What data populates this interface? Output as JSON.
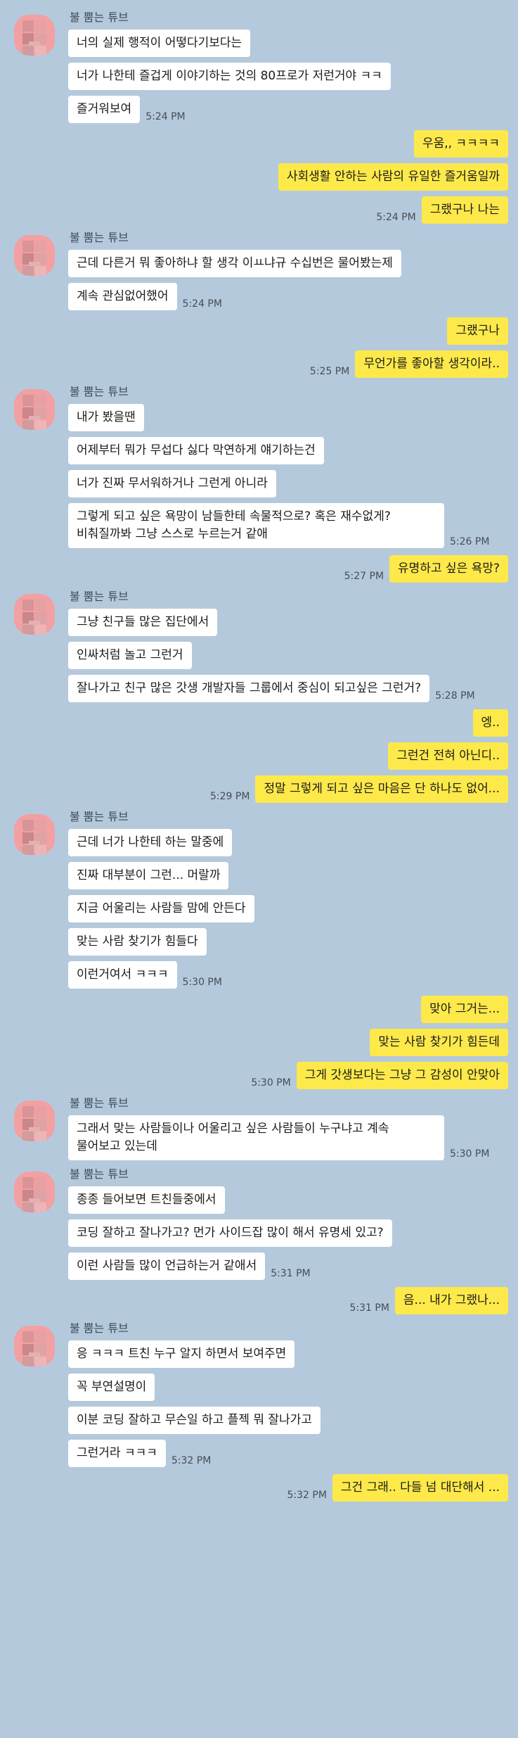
{
  "conversation": {
    "groups": [
      {
        "side": "in",
        "name": "불 뿜는 튜브",
        "messages": [
          {
            "text": "너의 실제 행적이 어떻다기보다는",
            "time": ""
          },
          {
            "text": "너가 나한테 즐겁게 이야기하는 것의 80프로가 저런거야 ㅋㅋ",
            "time": ""
          },
          {
            "text": "즐거워보여",
            "time": "5:24 PM"
          }
        ]
      },
      {
        "side": "out",
        "messages": [
          {
            "text": "우움,, ㅋㅋㅋㅋ",
            "time": ""
          },
          {
            "text": "사회생활 안하는 사람의 유일한 즐거움일까",
            "time": ""
          },
          {
            "text": "그랬구나 나는",
            "time": "5:24 PM"
          }
        ]
      },
      {
        "side": "in",
        "name": "불 뿜는 튜브",
        "messages": [
          {
            "text": "근데 다른거 뭐 좋아하냐 할 생각 이ㅛ냐규 수십번은 물어봤는제",
            "time": ""
          },
          {
            "text": "계속 관심없어했어",
            "time": "5:24 PM"
          }
        ]
      },
      {
        "side": "out",
        "messages": [
          {
            "text": "그랬구나",
            "time": ""
          },
          {
            "text": "무언가를 좋아할 생각이라..",
            "time": "5:25 PM"
          }
        ]
      },
      {
        "side": "in",
        "name": "불 뿜는 튜브",
        "messages": [
          {
            "text": "내가 봤을땐",
            "time": ""
          },
          {
            "text": "어제부터 뭐가 무섭다 싫다 막연하게 얘기하는건",
            "time": ""
          },
          {
            "text": "너가 진짜 무서워하거나 그런게 아니라",
            "time": ""
          },
          {
            "text": "그렇게 되고 싶은 욕망이 남들한테 속물적으로? 혹은 재수없게? 비춰질까봐 그냥 스스로 누르는거 같애",
            "time": "5:26 PM"
          }
        ]
      },
      {
        "side": "out",
        "messages": [
          {
            "text": "유명하고 싶은 욕망?",
            "time": "5:27 PM"
          }
        ]
      },
      {
        "side": "in",
        "name": "불 뿜는 튜브",
        "messages": [
          {
            "text": "그냥 친구들 많은 집단에서",
            "time": ""
          },
          {
            "text": "인싸처럼 놀고 그런거",
            "time": ""
          },
          {
            "text": "잘나가고 친구 많은 갓생 개발자들 그룹에서 중심이 되고싶은 그런거?",
            "time": "5:28 PM"
          }
        ]
      },
      {
        "side": "out",
        "messages": [
          {
            "text": "엥..",
            "time": ""
          },
          {
            "text": "그런건 전혀 아닌디..",
            "time": ""
          },
          {
            "text": "정말 그렇게 되고 싶은 마음은 단 하나도 없어...",
            "time": "5:29 PM"
          }
        ]
      },
      {
        "side": "in",
        "name": "불 뿜는 튜브",
        "messages": [
          {
            "text": "근데 너가 나한테 하는 말중에",
            "time": ""
          },
          {
            "text": "진짜 대부분이 그런... 머랄까",
            "time": ""
          },
          {
            "text": "지금 어울리는 사람들 맘에 안든다",
            "time": ""
          },
          {
            "text": "맞는 사람 찾기가 힘들다",
            "time": ""
          },
          {
            "text": "이런거여서 ㅋㅋㅋ",
            "time": "5:30 PM"
          }
        ]
      },
      {
        "side": "out",
        "messages": [
          {
            "text": "맞아 그거는...",
            "time": ""
          },
          {
            "text": "맞는 사람 찾기가 힘든데",
            "time": ""
          },
          {
            "text": "그게 갓생보다는 그냥 그 감성이 안맞아",
            "time": "5:30 PM"
          }
        ]
      },
      {
        "side": "in",
        "name": "불 뿜는 튜브",
        "messages": [
          {
            "text": "그래서 맞는 사람들이나 어울리고 싶은 사람들이 누구냐고 계속 물어보고 있는데",
            "time": "5:30 PM"
          }
        ]
      },
      {
        "side": "in",
        "name": "불 뿜는 튜브",
        "messages": [
          {
            "text": "종종 들어보면 트친들중에서",
            "time": ""
          },
          {
            "text": "코딩 잘하고 잘나가고? 먼가 사이드잡 많이 해서 유명세 있고?",
            "time": ""
          },
          {
            "text": "이런 사람들 많이 언급하는거 같애서",
            "time": "5:31 PM"
          }
        ]
      },
      {
        "side": "out",
        "messages": [
          {
            "text": "음... 내가 그랬나...",
            "time": "5:31 PM"
          }
        ]
      },
      {
        "side": "in",
        "name": "불 뿜는 튜브",
        "messages": [
          {
            "text": "응 ㅋㅋㅋ 트친 누구 알지 하면서 보여주면",
            "time": ""
          },
          {
            "text": "꼭 부연설명이",
            "time": ""
          },
          {
            "text": "이분 코딩 잘하고 무슨일 하고 플젝 뭐 잘나가고",
            "time": ""
          },
          {
            "text": "그런거라 ㅋㅋㅋ",
            "time": "5:32 PM"
          }
        ]
      },
      {
        "side": "out",
        "messages": [
          {
            "text": "그건 그래.. 다들 넘 대단해서 ...",
            "time": "5:32 PM"
          }
        ]
      }
    ]
  }
}
